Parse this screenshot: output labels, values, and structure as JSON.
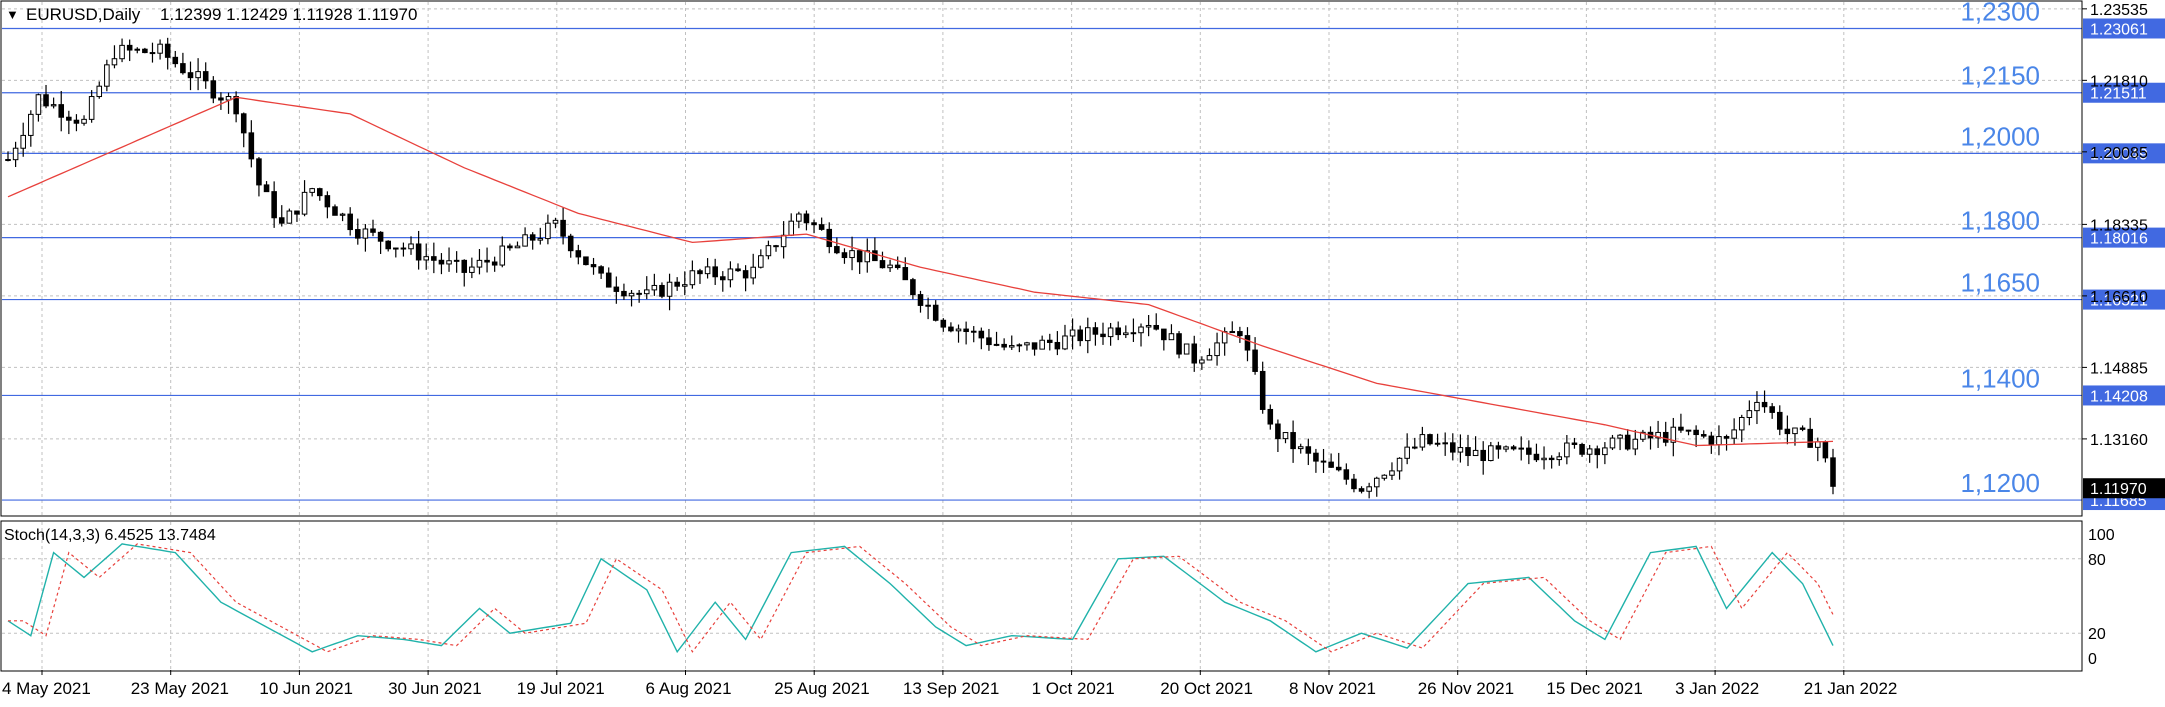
{
  "header": {
    "symbol_tf": "EURUSD,Daily",
    "ohlc": "1.12399 1.12429 1.11928 1.11970"
  },
  "stoch": {
    "label": "Stoch(14,3,3) 6.4525 13.7484"
  },
  "colors": {
    "background": "#ffffff",
    "grid": "#c0c0c0",
    "level_line": "#4169e1",
    "level_text": "#4a86e8",
    "ma": "#e8413c",
    "stoch_main": "#20b2aa",
    "stoch_signal": "#e8413c",
    "bull_candle": "#ffffff",
    "bear_candle": "#000000"
  },
  "chart_data": [
    {
      "type": "candlestick",
      "symbol": "EURUSD",
      "timeframe": "Daily",
      "ylim": [
        1.113,
        1.237
      ],
      "grid": true,
      "x_tick_labels": [
        "4 May 2021",
        "23 May 2021",
        "10 Jun 2021",
        "30 Jun 2021",
        "19 Jul 2021",
        "6 Aug 2021",
        "25 Aug 2021",
        "13 Sep 2021",
        "1 Oct 2021",
        "20 Oct 2021",
        "8 Nov 2021",
        "26 Nov 2021",
        "15 Dec 2021",
        "3 Jan 2022",
        "21 Jan 2022"
      ],
      "y_tick_labels": [
        "1.23535",
        "1.21810",
        "1.20085",
        "1.18335",
        "1.16610",
        "1.14885",
        "1.13160"
      ],
      "y_ticks": [
        1.23535,
        1.2181,
        1.20085,
        1.18335,
        1.1661,
        1.14885,
        1.1316
      ],
      "levels": [
        {
          "value": 1.23061,
          "label": "1,2300",
          "axis_label": "1.23061"
        },
        {
          "value": 1.21511,
          "label": "1,2150",
          "axis_label": "1.21511"
        },
        {
          "value": 1.20049,
          "label": "1,2000",
          "axis_label": "1.20049"
        },
        {
          "value": 1.18016,
          "label": "1,1800",
          "axis_label": "1.18016"
        },
        {
          "value": 1.16521,
          "label": "1,1650",
          "axis_label": "1.16521"
        },
        {
          "value": 1.14208,
          "label": "1,1400",
          "axis_label": "1.14208"
        },
        {
          "value": 1.11685,
          "label": "1,1200",
          "axis_label": "1.11685"
        }
      ],
      "current_price": {
        "value": 1.1197,
        "label": "1.11970"
      },
      "price_anchors": [
        [
          0,
          1.199
        ],
        [
          4,
          1.214
        ],
        [
          10,
          1.208
        ],
        [
          14,
          1.225
        ],
        [
          20,
          1.225
        ],
        [
          26,
          1.217
        ],
        [
          30,
          1.212
        ],
        [
          33,
          1.193
        ],
        [
          36,
          1.183
        ],
        [
          40,
          1.192
        ],
        [
          46,
          1.182
        ],
        [
          53,
          1.177
        ],
        [
          60,
          1.172
        ],
        [
          66,
          1.177
        ],
        [
          72,
          1.183
        ],
        [
          78,
          1.17
        ],
        [
          84,
          1.166
        ],
        [
          90,
          1.171
        ],
        [
          98,
          1.172
        ],
        [
          104,
          1.186
        ],
        [
          110,
          1.177
        ],
        [
          116,
          1.173
        ],
        [
          123,
          1.16
        ],
        [
          132,
          1.153
        ],
        [
          140,
          1.156
        ],
        [
          150,
          1.16
        ],
        [
          156,
          1.151
        ],
        [
          162,
          1.158
        ],
        [
          166,
          1.134
        ],
        [
          172,
          1.126
        ],
        [
          178,
          1.12
        ],
        [
          186,
          1.131
        ],
        [
          192,
          1.128
        ],
        [
          200,
          1.128
        ],
        [
          210,
          1.13
        ],
        [
          220,
          1.133
        ],
        [
          226,
          1.131
        ],
        [
          230,
          1.142
        ],
        [
          234,
          1.133
        ],
        [
          238,
          1.131
        ],
        [
          240,
          1.121
        ]
      ],
      "ma_anchors": [
        [
          0,
          1.19
        ],
        [
          15,
          1.202
        ],
        [
          30,
          1.214
        ],
        [
          45,
          1.21
        ],
        [
          60,
          1.197
        ],
        [
          75,
          1.186
        ],
        [
          90,
          1.179
        ],
        [
          105,
          1.181
        ],
        [
          120,
          1.173
        ],
        [
          135,
          1.167
        ],
        [
          150,
          1.164
        ],
        [
          165,
          1.154
        ],
        [
          180,
          1.145
        ],
        [
          195,
          1.14
        ],
        [
          210,
          1.135
        ],
        [
          222,
          1.13
        ],
        [
          240,
          1.131
        ]
      ],
      "stoch_anchors": [
        [
          0,
          30
        ],
        [
          3,
          18
        ],
        [
          6,
          85
        ],
        [
          10,
          65
        ],
        [
          15,
          92
        ],
        [
          22,
          85
        ],
        [
          28,
          45
        ],
        [
          34,
          25
        ],
        [
          40,
          5
        ],
        [
          46,
          18
        ],
        [
          52,
          15
        ],
        [
          57,
          10
        ],
        [
          62,
          40
        ],
        [
          66,
          20
        ],
        [
          74,
          28
        ],
        [
          78,
          80
        ],
        [
          84,
          55
        ],
        [
          88,
          5
        ],
        [
          93,
          45
        ],
        [
          97,
          15
        ],
        [
          103,
          85
        ],
        [
          110,
          90
        ],
        [
          116,
          60
        ],
        [
          122,
          25
        ],
        [
          126,
          10
        ],
        [
          132,
          18
        ],
        [
          140,
          15
        ],
        [
          146,
          80
        ],
        [
          152,
          82
        ],
        [
          160,
          45
        ],
        [
          166,
          30
        ],
        [
          172,
          5
        ],
        [
          178,
          20
        ],
        [
          184,
          8
        ],
        [
          192,
          60
        ],
        [
          200,
          65
        ],
        [
          206,
          30
        ],
        [
          210,
          15
        ],
        [
          216,
          85
        ],
        [
          222,
          90
        ],
        [
          226,
          40
        ],
        [
          232,
          85
        ],
        [
          236,
          60
        ],
        [
          240,
          10
        ]
      ],
      "stoch_ylim": [
        0,
        100
      ],
      "stoch_ticks": [
        100,
        80,
        20,
        0
      ],
      "n_bars": 241
    }
  ]
}
